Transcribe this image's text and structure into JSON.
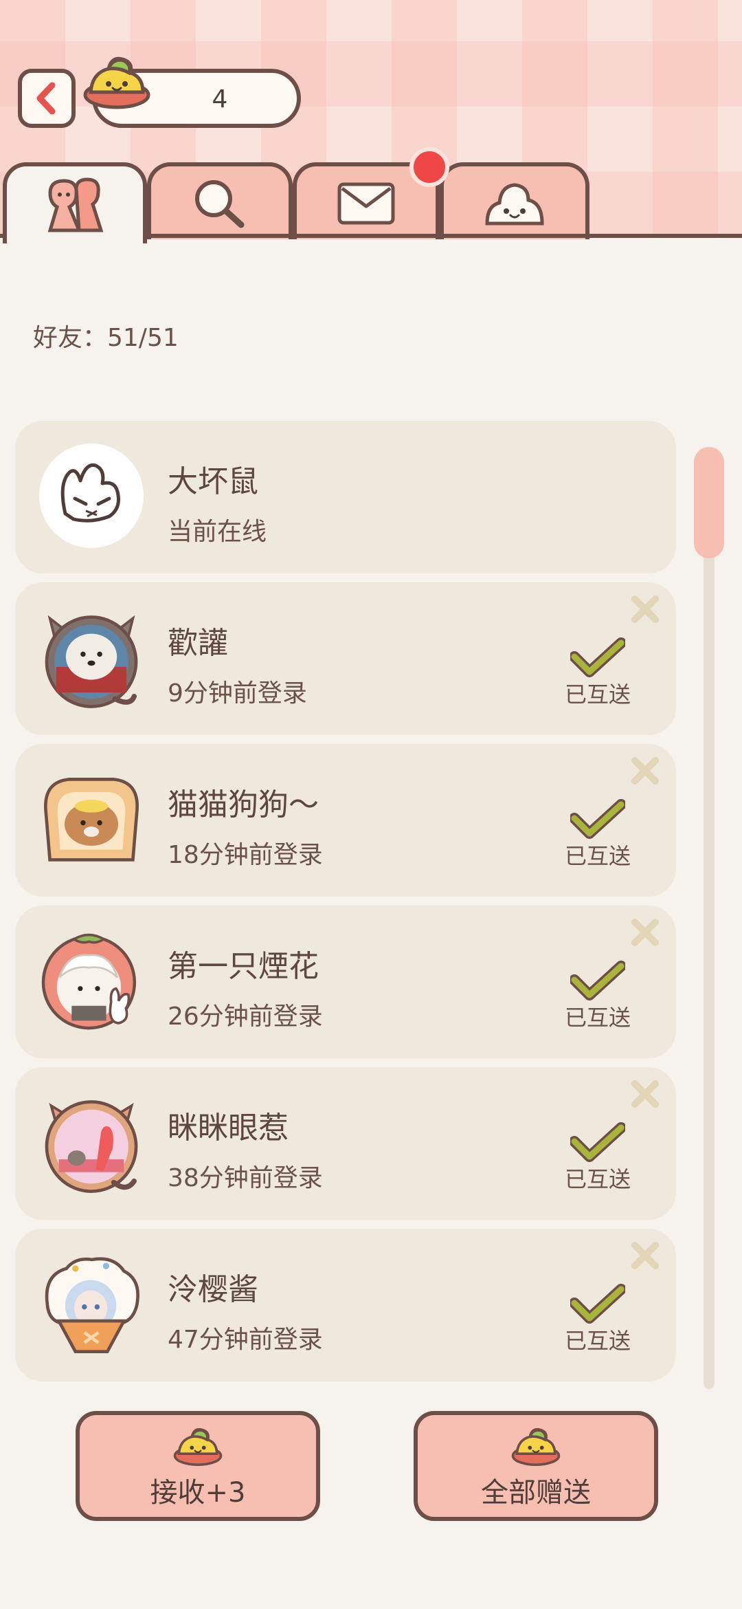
{
  "header": {
    "currency_count": "4",
    "tabs": [
      {
        "icon": "friends-icon"
      },
      {
        "icon": "search-icon"
      },
      {
        "icon": "mail-icon"
      },
      {
        "icon": "blob-icon"
      }
    ]
  },
  "friends_label": "好友：51/51",
  "friends": [
    {
      "name": "大坏鼠",
      "status": "当前在线",
      "avatar": "rabbit-avatar",
      "sent": ""
    },
    {
      "name": "歡讙",
      "status": "9分钟前登录",
      "avatar": "dog-avatar",
      "sent": "已互送"
    },
    {
      "name": "猫猫狗狗～",
      "status": "18分钟前登录",
      "avatar": "toast-bear-avatar",
      "sent": "已互送"
    },
    {
      "name": "第一只煙花",
      "status": "26分钟前登录",
      "avatar": "strawberry-avatar",
      "sent": "已互送"
    },
    {
      "name": "眯眯眼惹",
      "status": "38分钟前登录",
      "avatar": "cat-frame-avatar",
      "sent": "已互送"
    },
    {
      "name": "泠樱酱",
      "status": "47分钟前登录",
      "avatar": "anime-girl-avatar",
      "sent": "已互送"
    }
  ],
  "buttons": {
    "receive_label": "接收+3",
    "send_all_label": "全部赠送"
  },
  "colors": {
    "accent": "#f7bfb2",
    "outline": "#6e4f48",
    "card": "#efe8dc",
    "check": "#a9b53a",
    "notify": "#ef4646"
  }
}
